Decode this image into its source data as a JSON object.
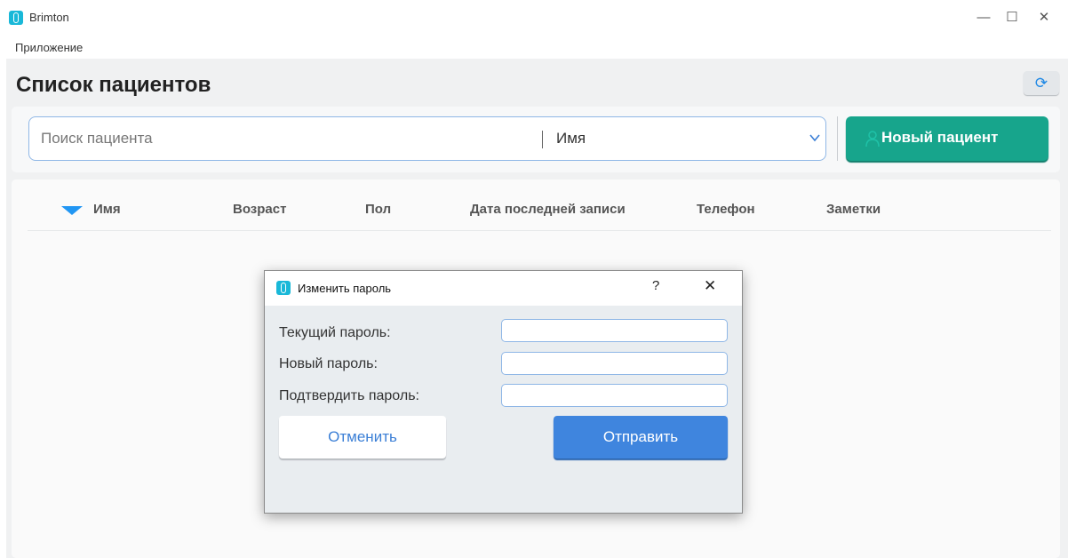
{
  "app": {
    "title": "Brimton"
  },
  "window_controls": {
    "minimize": "—",
    "maximize": "☐",
    "close": "✕"
  },
  "menu": {
    "items": [
      "Приложение"
    ]
  },
  "page": {
    "title": "Список пациентов"
  },
  "search": {
    "placeholder": "Поиск пациента",
    "value": "",
    "field_selected": "Имя",
    "new_patient_label": "Новый пациент"
  },
  "table": {
    "columns": [
      "Имя",
      "Возраст",
      "Пол",
      "Дата последней записи",
      "Телефон",
      "Заметки"
    ],
    "sort_column": "Имя",
    "sort_direction": "descending",
    "rows": []
  },
  "dialog": {
    "title": "Изменить пароль",
    "help": "?",
    "close": "✕",
    "fields": [
      {
        "label": "Текущий пароль:",
        "value": ""
      },
      {
        "label": "Новый пароль:",
        "value": ""
      },
      {
        "label": "Подтвердить пароль:",
        "value": ""
      }
    ],
    "cancel_label": "Отменить",
    "submit_label": "Отправить"
  },
  "colors": {
    "accent_blue": "#3f85de",
    "accent_green": "#17a58c",
    "sort_indicator": "#2196f3",
    "app_icon": "#19b8d8"
  },
  "icons": {
    "app": "app-logo-icon",
    "refresh": "refresh-icon",
    "dropdown": "chevron-down-icon",
    "new_patient": "user-plus-icon",
    "sort": "sort-desc-icon"
  }
}
